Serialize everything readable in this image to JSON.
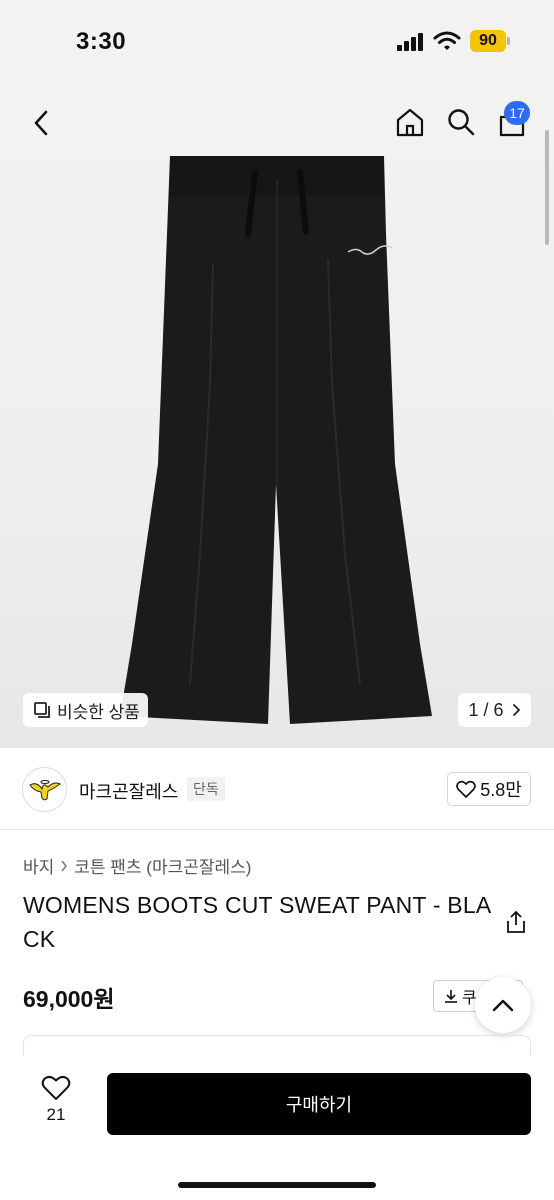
{
  "status_bar": {
    "time": "3:30",
    "battery": "90"
  },
  "top_nav": {
    "cart_count": "17",
    "icons": [
      "back-icon",
      "home-icon",
      "search-icon",
      "cart-icon"
    ]
  },
  "gallery": {
    "similar_label": "비슷한 상품",
    "page_indicator": "1 / 6"
  },
  "brand": {
    "name": "마크곤잘레스",
    "tag": "단독",
    "likes": "5.8만"
  },
  "breadcrumb": {
    "category": "바지",
    "subcategory": "코튼 팬츠 (마크곤잘레스)"
  },
  "product": {
    "title": "WOMENS BOOTS CUT SWEAT PANT - BLACK",
    "price": "69,000원",
    "coupon_label": "쿠폰"
  },
  "bottom_bar": {
    "wish_count": "21",
    "buy_label": "구매하기"
  },
  "colors": {
    "accent_badge": "#2c6cf5",
    "battery": "#f5c400",
    "buy_button": "#000000"
  }
}
